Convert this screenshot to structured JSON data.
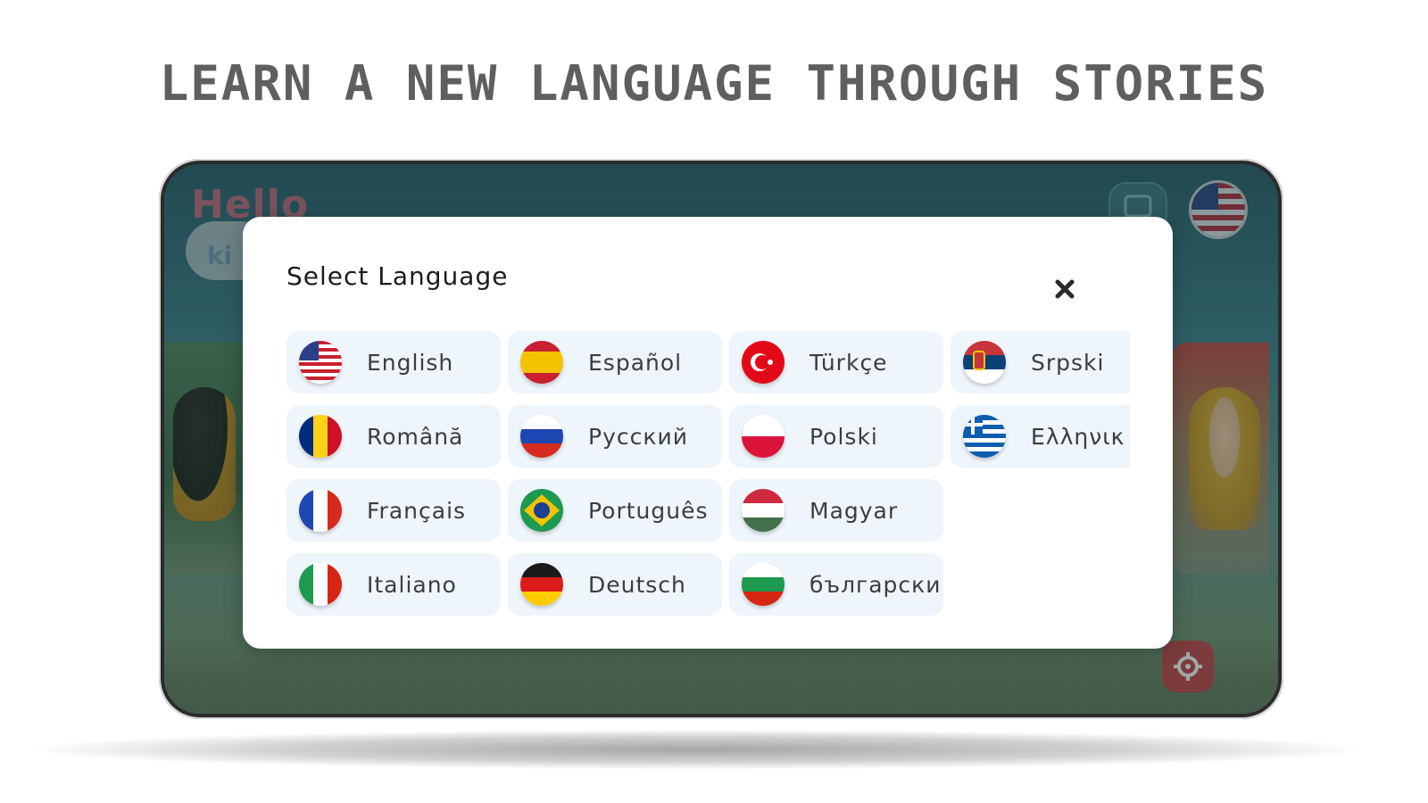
{
  "headline": "LEARN A NEW LANGUAGE THROUGH STORIES",
  "app": {
    "logo_text": "Hello",
    "logo_sub": "ki",
    "current_language_flag": "us-flag-icon"
  },
  "modal": {
    "title": "Select Language",
    "close_icon": "close-icon",
    "languages": [
      {
        "label": "English",
        "flag": "us"
      },
      {
        "label": "Español",
        "flag": "es"
      },
      {
        "label": "Türkçe",
        "flag": "tr"
      },
      {
        "label": "Srpski",
        "flag": "rs"
      },
      {
        "label": "Română",
        "flag": "ro"
      },
      {
        "label": "Русский",
        "flag": "ru"
      },
      {
        "label": "Polski",
        "flag": "pl"
      },
      {
        "label": "Ελληνικ",
        "flag": "gr"
      },
      {
        "label": "Français",
        "flag": "fr"
      },
      {
        "label": "Português",
        "flag": "br"
      },
      {
        "label": "Magyar",
        "flag": "hu"
      },
      {
        "label": "Italiano",
        "flag": "it"
      },
      {
        "label": "Deutsch",
        "flag": "de"
      },
      {
        "label": "български",
        "flag": "bg"
      }
    ]
  },
  "colors": {
    "chip_background": "#eef5fb",
    "settings_button": "#c23b45",
    "headline_text": "#5f5f5f"
  }
}
